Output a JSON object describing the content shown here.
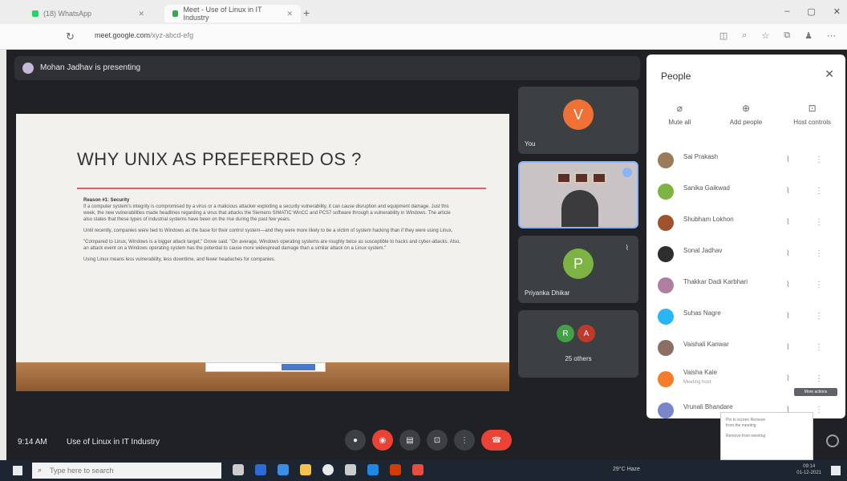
{
  "browser": {
    "tab1_title": "(18) WhatsApp",
    "tab2_title": "Meet - Use of Linux in IT Industry",
    "url_domain": "meet.google.com",
    "url_rest": "/xyz-abcd-efg"
  },
  "meet": {
    "presenting_text": "Mohan Jadhav is presenting",
    "clock": "9:14 AM",
    "meeting_title": "Use of Linux in IT Industry"
  },
  "slide": {
    "title": "WHY UNIX AS PREFERRED OS ?",
    "heading": "Reason #1: Security",
    "para1": "If a computer system's integrity is compromised by a virus or a malicious attacker exploiting a security vulnerability, it can cause disruption and equipment damage. Just this week, the new vulnerabilities made headlines regarding a virus that attacks the Siemens SIMATIC WinCC and PCS7 software through a vulnerability in Windows. The article also states that these types of industrial systems have been on the rise during the past few years.",
    "para2": "Until recently, companies were tied to Windows as the base for their control system—and they were more likely to be a victim of system hacking than if they were using Linux.",
    "para3": "\"Compared to Linux, Windows is a bigger attack target,\" Grove said. \"On average, Windows operating systems are roughly twice as susceptible to hacks and cyber-attacks. Also, an attack event on a Windows operating system has the potential to cause more widespread damage than a similar attack on a Linux system.\"",
    "para4": "Using Linux means less vulnerability, less downtime, and fewer headaches for companies."
  },
  "tiles": [
    {
      "name": "You",
      "initial": "V",
      "color": "#f07136"
    },
    {
      "name": "",
      "initial": "",
      "color": ""
    },
    {
      "name": "Priyanka Dhikar",
      "initial": "P",
      "color": "#7cb342"
    },
    {
      "name": "25 others",
      "initial": "",
      "color": ""
    }
  ],
  "others_avatars": [
    {
      "initial": "R",
      "color": "#43a047"
    },
    {
      "initial": "A",
      "color": "#c0392b"
    }
  ],
  "people": {
    "title": "People",
    "mute_all": "Mute all",
    "add_people": "Add people",
    "host_controls": "Host controls",
    "list": [
      {
        "name": "Sai Prakash",
        "sub": "",
        "color": "#9c7b5c"
      },
      {
        "name": "Sanika Gaikwad",
        "sub": "",
        "color": "#7cb342"
      },
      {
        "name": "Shubham Lokhon",
        "sub": "",
        "color": "#a0522d"
      },
      {
        "name": "Sonal Jadhav",
        "sub": "",
        "color": "#2e2e2e"
      },
      {
        "name": "Thakkar Dadi Karbhari",
        "sub": "",
        "color": "#b07fa0"
      },
      {
        "name": "Suhas Nagre",
        "sub": "",
        "color": "#29b6f6"
      },
      {
        "name": "Vaishali Kanwar",
        "sub": "",
        "color": "#8d6e63"
      },
      {
        "name": "Vaisha Kale",
        "sub": "Meeting host",
        "color": "#f57c2a"
      },
      {
        "name": "Vrunali Bhandare",
        "sub": "",
        "color": "#7986cb"
      }
    ],
    "tooltip": "More actions",
    "menu_line1": "Pin to screen Remove",
    "menu_line2": "from the meeting",
    "menu_line3": "Remove from meeting"
  },
  "taskbar": {
    "search_placeholder": "Type here to search",
    "weather": "29°C Haze",
    "time": "09:14",
    "date": "01-12-2021"
  }
}
